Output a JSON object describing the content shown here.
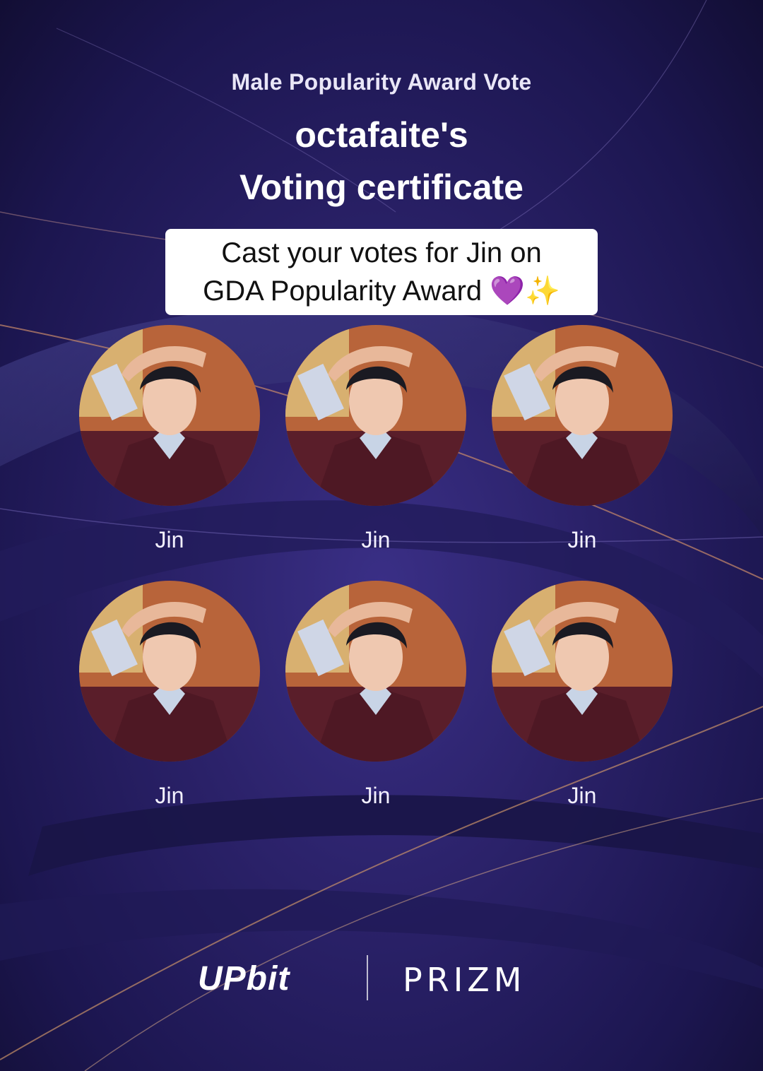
{
  "certificate": {
    "subtitle": "Male Popularity Award Vote",
    "title_line1": "octafaite's",
    "title_line2": "Voting certificate"
  },
  "caption": {
    "line1": "Cast your votes for Jin on",
    "line2": "GDA Popularity Award 💜✨"
  },
  "votes": [
    {
      "name": "Jin"
    },
    {
      "name": "Jin"
    },
    {
      "name": "Jin"
    },
    {
      "name": "Jin"
    },
    {
      "name": "Jin"
    },
    {
      "name": "Jin"
    }
  ],
  "footer": {
    "brand1": "UPbit",
    "brand2": "PRIZM"
  },
  "colors": {
    "background": "#2a2168",
    "text": "#ffffff",
    "caption_bg": "#ffffff",
    "accent_line": "#c98a6a"
  }
}
